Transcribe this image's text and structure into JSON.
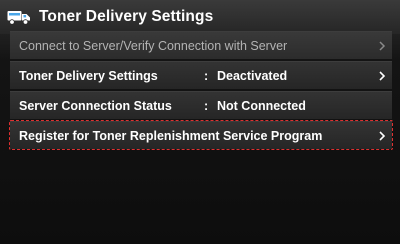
{
  "header": {
    "title": "Toner Delivery Settings",
    "icon": "delivery-truck-icon"
  },
  "rows": [
    {
      "label": "Connect to Server/Verify Connection with Server",
      "value": "",
      "colon": "",
      "enabled": false
    },
    {
      "label": "Toner Delivery Settings",
      "colon": ":",
      "value": "Deactivated",
      "enabled": true
    },
    {
      "label": "Server Connection Status",
      "colon": ":",
      "value": "Not Connected",
      "enabled": true
    },
    {
      "label": "Register for Toner Replenishment Service Program",
      "value": "",
      "colon": "",
      "enabled": true
    }
  ],
  "colors": {
    "highlight": "#e03030",
    "text": "#ffffff",
    "disabled_text": "#b3b3b3"
  }
}
